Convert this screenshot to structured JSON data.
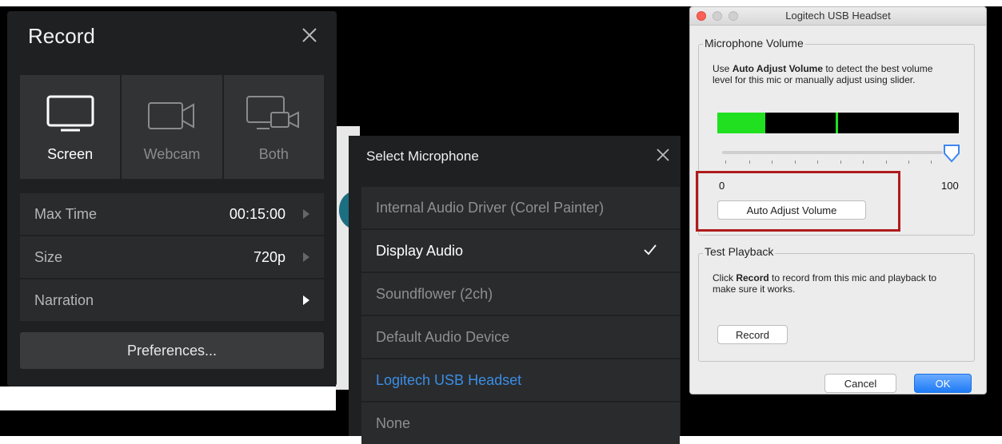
{
  "record_panel": {
    "title": "Record",
    "modes": [
      {
        "label": "Screen",
        "icon": "monitor-icon",
        "active": true
      },
      {
        "label": "Webcam",
        "icon": "webcam-icon",
        "active": false
      },
      {
        "label": "Both",
        "icon": "monitor-webcam-icon",
        "active": false
      }
    ],
    "max_time_label": "Max Time",
    "max_time_value": "00:15:00",
    "size_label": "Size",
    "size_value": "720p",
    "narration_label": "Narration",
    "preferences_label": "Preferences..."
  },
  "mic_panel": {
    "title": "Select Microphone",
    "items": [
      {
        "label": "Internal Audio Driver (Corel Painter)"
      },
      {
        "label": "Display Audio"
      },
      {
        "label": "Soundflower (2ch)"
      },
      {
        "label": "Default Audio Device"
      },
      {
        "label": "Logitech USB Headset"
      },
      {
        "label": "None"
      }
    ],
    "checked_index": 1,
    "highlighted_index": 4
  },
  "dialog": {
    "title": "Logitech USB Headset",
    "mic_volume_group": "Microphone Volume",
    "mic_desc_pre": "Use ",
    "mic_desc_bold": "Auto Adjust Volume",
    "mic_desc_post": " to detect the best volume level for this mic or manually adjust using slider.",
    "slider_min": "0",
    "slider_max": "100",
    "slider_value": 100,
    "meter_level": 0.2,
    "meter_peak": 0.49,
    "auto_adjust_label": "Auto Adjust Volume",
    "test_playback_group": "Test Playback",
    "test_desc_pre": "Click ",
    "test_desc_bold": "Record",
    "test_desc_post": " to record from this mic and playback to make sure it works.",
    "record_label": "Record",
    "cancel_label": "Cancel",
    "ok_label": "OK"
  },
  "colors": {
    "panel_bg": "#1f2022",
    "tile_bg": "#323335",
    "accent_blue": "#3a8ee6",
    "meter_green": "#20e020",
    "highlight_red": "#b01c1c",
    "ok_blue": "#1f7cf6"
  }
}
